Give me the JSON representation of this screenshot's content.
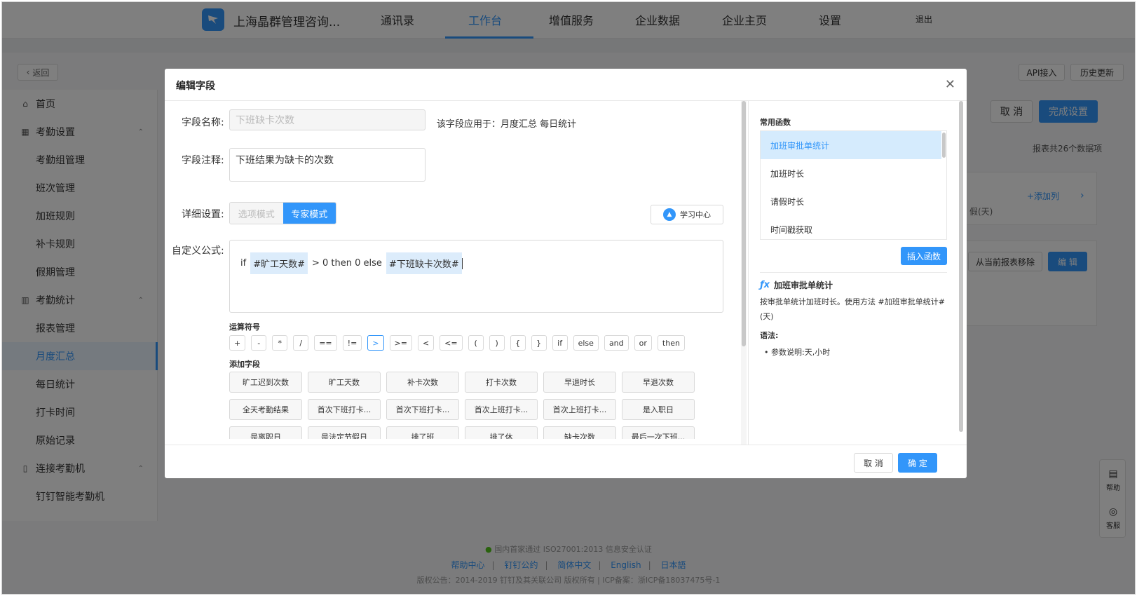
{
  "topnav": {
    "company": "上海晶群管理咨询...",
    "items": [
      "通讯录",
      "工作台",
      "增值服务",
      "企业数据",
      "企业主页",
      "设置"
    ],
    "active_index": 1,
    "logout": "退出"
  },
  "toolbar": {
    "back": "返回",
    "api": "API接入",
    "history": "历史更新"
  },
  "sidebar": {
    "items": [
      {
        "label": "首页",
        "type": "group",
        "icon": "home-icon"
      },
      {
        "label": "考勤设置",
        "type": "group",
        "icon": "grid-icon"
      },
      {
        "label": "考勤组管理",
        "type": "sub"
      },
      {
        "label": "班次管理",
        "type": "sub"
      },
      {
        "label": "加班规则",
        "type": "sub"
      },
      {
        "label": "补卡规则",
        "type": "sub"
      },
      {
        "label": "假期管理",
        "type": "sub"
      },
      {
        "label": "考勤统计",
        "type": "group",
        "icon": "chart-icon"
      },
      {
        "label": "报表管理",
        "type": "sub"
      },
      {
        "label": "月度汇总",
        "type": "sub",
        "active": true
      },
      {
        "label": "每日统计",
        "type": "sub"
      },
      {
        "label": "打卡时间",
        "type": "sub"
      },
      {
        "label": "原始记录",
        "type": "sub"
      },
      {
        "label": "连接考勤机",
        "type": "group",
        "icon": "device-icon"
      },
      {
        "label": "钉钉智能考勤机",
        "type": "sub"
      }
    ]
  },
  "page": {
    "cancel": "取 消",
    "finish": "完成设置",
    "report_count": "报表共26个数据项",
    "add_column": "+添加列",
    "days_col": "假(天)",
    "remove_from_report": "从当前报表移除",
    "edit": "编 辑"
  },
  "footer": {
    "cert": "国内首家通过 ISO27001:2013 信息安全认证",
    "links": [
      "帮助中心",
      "钉钉公约",
      "简体中文",
      "English",
      "日本語"
    ],
    "copyright": "版权公告：2014-2019 钉钉及其关联公司 版权所有 | ICP备案：浙ICP备18037475号-1"
  },
  "float": {
    "help": "帮助",
    "service": "客服"
  },
  "modal": {
    "title": "编辑字段",
    "name_label": "字段名称:",
    "name_placeholder": "下班缺卡次数",
    "applies_to": "该字段应用于：月度汇总 每日统计",
    "note_label": "字段注释:",
    "note_value": "下班结果为缺卡的次数",
    "detail_label": "详细设置:",
    "modes": [
      "选项模式",
      "专家模式"
    ],
    "active_mode": 1,
    "learn_center": "学习中心",
    "formula_label": "自定义公式:",
    "formula_tokens": [
      {
        "text": "if",
        "field": false
      },
      {
        "text": "#旷工天数#",
        "field": true
      },
      {
        "text": "> 0 then 0 else",
        "field": false
      },
      {
        "text": "#下班缺卡次数#",
        "field": true
      }
    ],
    "operators_title": "运算符号",
    "operators": [
      "+",
      "-",
      "*",
      "/",
      "==",
      "!=",
      ">",
      ">=",
      "<",
      "<=",
      "(",
      ")",
      "{",
      "}",
      "if",
      "else",
      "and",
      "or",
      "then"
    ],
    "active_operator": ">",
    "fields_title": "添加字段",
    "fields": [
      "旷工迟到次数",
      "旷工天数",
      "补卡次数",
      "打卡次数",
      "早退时长",
      "早退次数",
      "全天考勤结果",
      "首次下班打卡...",
      "首次下班打卡...",
      "首次上班打卡...",
      "首次上班打卡...",
      "是入职日",
      "是离职日",
      "是法定节假日",
      "排了班",
      "排了休",
      "缺卡次数",
      "最后一次下班..."
    ],
    "functions_title": "常用函数",
    "functions": [
      "加班审批单统计",
      "加班时长",
      "请假时长",
      "时间戳获取"
    ],
    "active_function": 0,
    "insert_function": "插入函数",
    "fn_name": "加班审批单统计",
    "fn_desc": "按审批单统计加班时长。使用方法 #加班审批单统计#(天)",
    "syntax_label": "语法:",
    "param_desc": "参数说明:天,小时",
    "cancel": "取 消",
    "confirm": "确 定"
  }
}
